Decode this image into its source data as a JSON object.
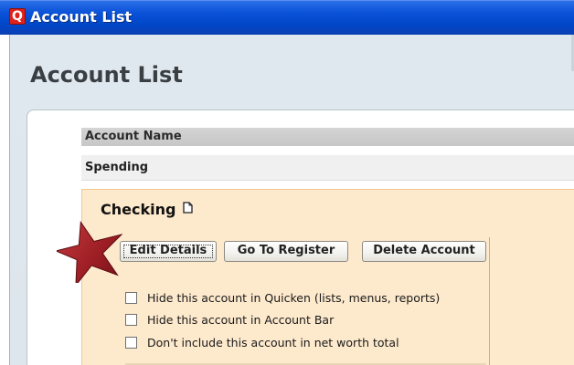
{
  "window": {
    "title": "Account List",
    "app_icon_letter": "Q"
  },
  "page": {
    "title": "Account List"
  },
  "table": {
    "column_header": "Account Name",
    "group_label": "Spending"
  },
  "account": {
    "name": "Checking",
    "buttons": {
      "edit": "Edit Details",
      "register": "Go To Register",
      "delete": "Delete Account"
    },
    "options": [
      {
        "label": "Hide this account in Quicken (lists, menus, reports)",
        "checked": false
      },
      {
        "label": "Hide this account in Account Bar",
        "checked": false
      },
      {
        "label": "Don't include this account in net worth total",
        "checked": false
      }
    ]
  },
  "colors": {
    "titlebar": "#0047c8",
    "account_card": "#fde9cc",
    "star": "#a8242a"
  },
  "icons": {
    "app": "quicken-q-icon",
    "account_doc": "document-icon",
    "callout": "star-icon"
  }
}
